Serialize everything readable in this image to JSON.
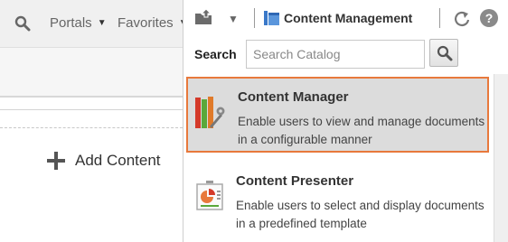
{
  "topbar": {
    "nav": [
      {
        "label": "Portals"
      },
      {
        "label": "Favorites"
      }
    ]
  },
  "main": {
    "add_content_label": "Add Content"
  },
  "panel": {
    "title": "Content Management",
    "search": {
      "label": "Search",
      "placeholder": "Search Catalog",
      "value": ""
    },
    "items": [
      {
        "name": "Content Manager",
        "description": "Enable users to view and manage documents in a configurable manner",
        "icon": "content-manager-icon",
        "selected": true
      },
      {
        "name": "Content Presenter",
        "description": "Enable users to select and display documents in a predefined template",
        "icon": "content-presenter-icon",
        "selected": false
      }
    ]
  },
  "colors": {
    "selection_border": "#e8793c",
    "selection_bg": "#dcdcdc"
  }
}
